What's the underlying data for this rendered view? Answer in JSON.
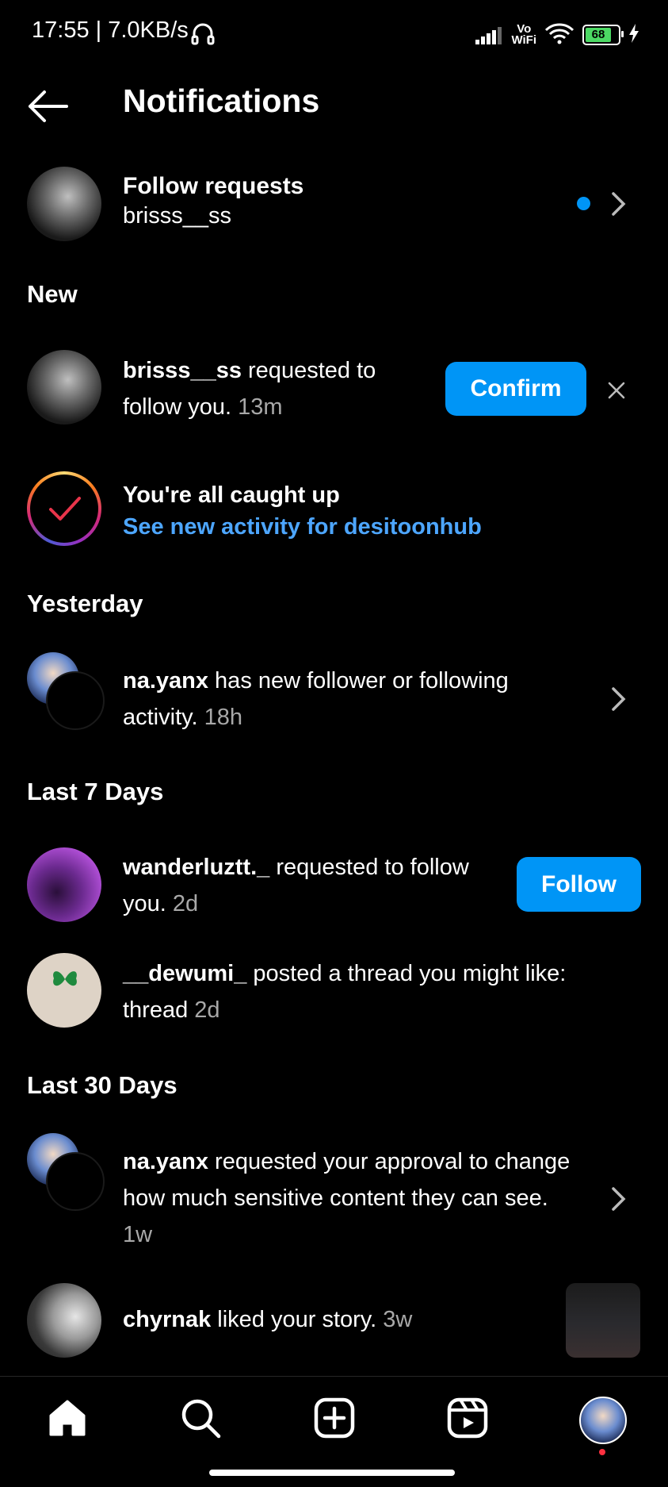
{
  "status_bar": {
    "time": "17:55 | 7.0KB/s",
    "vowifi_top": "Vo",
    "vowifi_bottom": "WiFi",
    "battery": "68"
  },
  "header": {
    "title": "Notifications"
  },
  "follow_requests": {
    "title": "Follow requests",
    "subtitle": "brisss__ss"
  },
  "sections": {
    "new": "New",
    "yesterday": "Yesterday",
    "last7": "Last 7 Days",
    "last30": "Last 30 Days"
  },
  "notifications": {
    "n1": {
      "user": "brisss__ss",
      "text": " requested to follow you.",
      "time": " 13m",
      "action": "Confirm"
    },
    "caught_up": {
      "title": "You're all caught up",
      "link": "See new activity for desitoonhub"
    },
    "n2": {
      "user": "na.yanx",
      "text": " has new follower or following activity.",
      "time": " 18h"
    },
    "n3": {
      "user": "wanderluztt._",
      "text": " requested to follow you.",
      "time": " 2d",
      "action": "Follow"
    },
    "n4": {
      "user": "__dewumi_",
      "text": " posted a thread you might like: thread",
      "time": " 2d"
    },
    "n5": {
      "user": "na.yanx",
      "text": " requested your approval to change how much sensitive content they can see.",
      "time": "1w"
    },
    "n6": {
      "user": "chyrnak",
      "text": " liked your story.",
      "time": " 3w"
    }
  },
  "colors": {
    "accent": "#0095f6",
    "link": "#4da6ff",
    "muted": "#a8a8a8",
    "background": "#000000"
  },
  "tab_bar": [
    "home-icon",
    "search-icon",
    "create-icon",
    "reels-icon",
    "profile-avatar"
  ]
}
